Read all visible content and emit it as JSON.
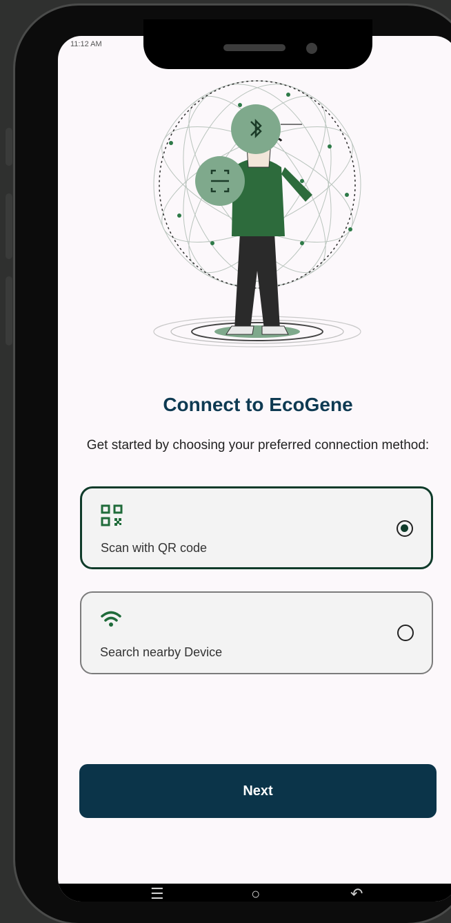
{
  "status_bar": {
    "time": "11:12 AM",
    "right": ""
  },
  "illustration": {
    "bluetooth_badge_icon": "bluetooth-icon",
    "scan_badge_icon": "scan-frame-icon"
  },
  "header": {
    "title": "Connect to EcoGene",
    "subtitle": "Get started by choosing your preferred connection method:"
  },
  "options": [
    {
      "label": "Scan with QR code",
      "icon": "qr-code-icon",
      "selected": true
    },
    {
      "label": "Search nearby Device",
      "icon": "wifi-icon",
      "selected": false
    }
  ],
  "next_button": {
    "label": "Next"
  },
  "nav_bar": {
    "items": [
      "menu-icon",
      "home-icon",
      "back-icon"
    ]
  },
  "colors": {
    "accent_dark": "#0b3449",
    "title": "#0e3a52",
    "selected_border": "#0f3b2a",
    "icon_green": "#1f6b3a",
    "badge_green": "#7fa98c",
    "background": "#fcf8fb"
  }
}
